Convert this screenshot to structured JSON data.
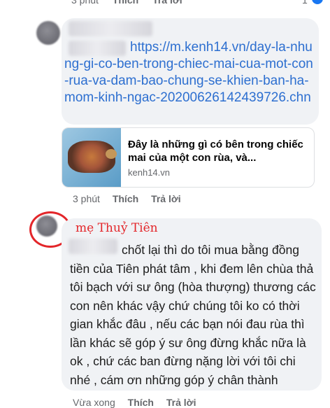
{
  "top_meta": {
    "time": "3 phút",
    "like": "Thích",
    "reply": "Trả lời",
    "reaction_count": "1"
  },
  "comment1": {
    "link_text": "https://m.kenh14.vn/day-la-nhung-gi-co-ben-trong-chiec-mai-cua-mot-con-rua-va-dam-bao-chung-se-khien-ban-ha-mom-kinh-ngac-20200626142439726.chn",
    "card": {
      "title": "Đây là những gì có bên trong chiếc mai của một con rùa, và...",
      "domain": "kenh14.vn"
    },
    "meta": {
      "time": "3 phút",
      "like": "Thích",
      "reply": "Trả lời"
    }
  },
  "comment2": {
    "author_annotation": "mẹ Thuỷ Tiên",
    "text": "chốt lại thì do tôi mua bằng đồng tiền của Tiên phát tâm , khi đem lên chùa thả tôi bạch với sư ông (hòa thượng) thương các con nên khác vậy chứ chúng tôi ko có thời gian khắc đâu , nếu các bạn nói đau rùa thì lần khác sẽ góp ý sư ông đừng khắc nữa là ok , chứ các ban đừng nặng lời với tôi chi nhé , cám ơn những góp ý chân thành",
    "meta": {
      "time": "Vừa xong",
      "like": "Thích",
      "reply": "Trả lời"
    }
  },
  "colors": {
    "link": "#2d6fd0",
    "annotation_red": "#e3262a",
    "bubble_bg": "#f0f2f5",
    "meta_gray": "#65676b"
  }
}
